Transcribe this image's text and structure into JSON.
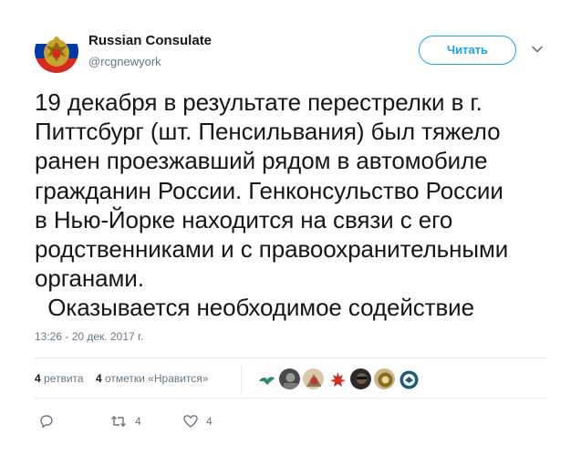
{
  "tweet": {
    "author": {
      "display_name": "Russian Consulate",
      "handle": "@rcgnewyork",
      "avatar": "russian-coat-of-arms"
    },
    "follow_label": "Читать",
    "text_lines": [
      "19 декабря в результате перестрелки в г.",
      "Питтсбург (шт. Пенсильвания) был тяжело",
      "ранен проезжавший рядом в автомобиле",
      "гражданин России. Генконсульство России",
      "в Нью-Йорке находится на связи с его",
      "родственниками и с правоохранительными",
      "органами.",
      "  Оказывается необходимое содействие"
    ],
    "timestamp": "13:26 - 20 дек. 2017 г.",
    "stats": {
      "retweets_count": "4",
      "retweets_label": "ретвита",
      "likes_count": "4",
      "likes_label": "отметки «Нравится»"
    },
    "actions": {
      "reply_count": "",
      "retweet_count": "4",
      "like_count": "4"
    }
  },
  "colors": {
    "accent": "#1da1f2",
    "secondary_text": "#657786",
    "primary_text": "#14171a",
    "divider": "#e6ecf0"
  }
}
